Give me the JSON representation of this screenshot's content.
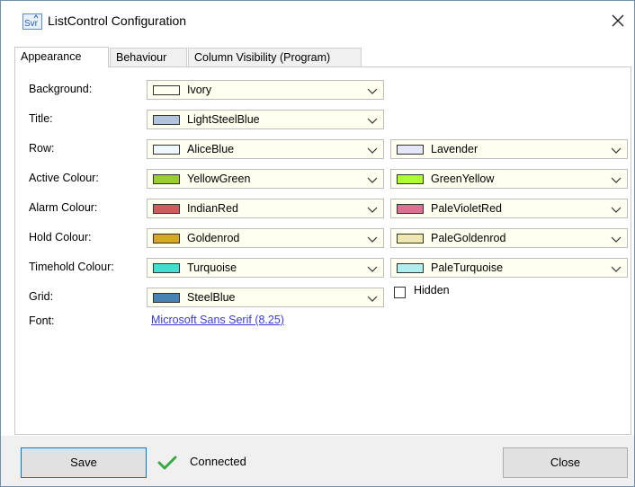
{
  "window": {
    "title": "ListControl Configuration",
    "icon_text": "Svr"
  },
  "tabs": [
    {
      "label": "Appearance",
      "active": true
    },
    {
      "label": "Behaviour",
      "active": false
    },
    {
      "label": "Column Visibility (Program)",
      "active": false
    }
  ],
  "rows": [
    {
      "label": "Background:",
      "primary": {
        "name": "Ivory",
        "color": "#FFFFF0"
      },
      "secondary": null
    },
    {
      "label": "Title:",
      "primary": {
        "name": "LightSteelBlue",
        "color": "#B0C4DE"
      },
      "secondary": null
    },
    {
      "label": "Row:",
      "primary": {
        "name": "AliceBlue",
        "color": "#F0F8FF"
      },
      "secondary": {
        "name": "Lavender",
        "color": "#E6E6FA"
      }
    },
    {
      "label": "Active Colour:",
      "primary": {
        "name": "YellowGreen",
        "color": "#9ACD32"
      },
      "secondary": {
        "name": "GreenYellow",
        "color": "#ADFF2F"
      }
    },
    {
      "label": "Alarm Colour:",
      "primary": {
        "name": "IndianRed",
        "color": "#CD5C5C"
      },
      "secondary": {
        "name": "PaleVioletRed",
        "color": "#DB7093"
      }
    },
    {
      "label": "Hold Colour:",
      "primary": {
        "name": "Goldenrod",
        "color": "#DAA520"
      },
      "secondary": {
        "name": "PaleGoldenrod",
        "color": "#EEE8AA"
      }
    },
    {
      "label": "Timehold Colour:",
      "primary": {
        "name": "Turquoise",
        "color": "#40E0D0"
      },
      "secondary": {
        "name": "PaleTurquoise",
        "color": "#AFEEEE"
      }
    },
    {
      "label": "Grid:",
      "primary": {
        "name": "SteelBlue",
        "color": "#4682B4"
      },
      "secondary": null
    }
  ],
  "grid_hidden": {
    "label": "Hidden",
    "checked": false
  },
  "font": {
    "label": "Font:",
    "value": "Microsoft Sans Serif (8.25)"
  },
  "footer": {
    "save_label": "Save",
    "status_text": "Connected",
    "status_color": "#3aa845",
    "close_label": "Close"
  },
  "colors": {
    "accent": "#0078d7",
    "combo_bg": "#fffff0",
    "link": "#3a3ad8"
  }
}
